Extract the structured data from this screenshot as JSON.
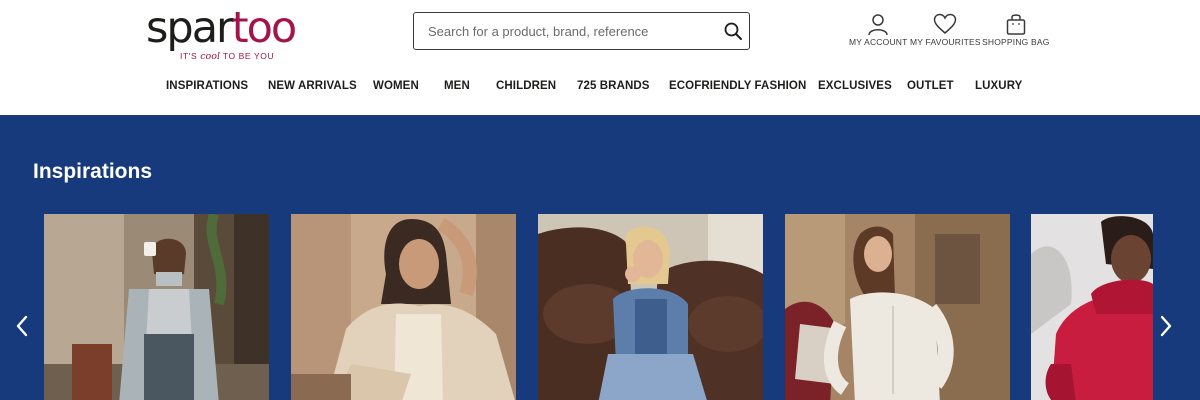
{
  "brand": {
    "name_part1": "spar",
    "name_part2": "too",
    "tagline_before": "IT'S ",
    "tagline_emph": "cool",
    "tagline_after": " TO BE YOU",
    "color_dark": "#1d1d1b",
    "color_accent": "#a3154a"
  },
  "search": {
    "placeholder": "Search for a product, brand, reference",
    "value": "",
    "icon": "search-icon"
  },
  "top_actions": [
    {
      "label": "MY ACCOUNT",
      "icon": "user-icon"
    },
    {
      "label": "MY FAVOURITES",
      "icon": "heart-icon"
    },
    {
      "label": "SHOPPING BAG",
      "icon": "shopping-bag-icon"
    }
  ],
  "nav": [
    {
      "label": "INSPIRATIONS"
    },
    {
      "label": "NEW ARRIVALS"
    },
    {
      "label": "WOMEN"
    },
    {
      "label": "MEN"
    },
    {
      "label": "CHILDREN"
    },
    {
      "label": "725 BRANDS"
    },
    {
      "label": "ECOFRIENDLY FASHION"
    },
    {
      "label": "EXCLUSIVES"
    },
    {
      "label": "OUTLET"
    },
    {
      "label": "LUXURY"
    }
  ],
  "inspirations": {
    "title": "Inspirations",
    "background": "#173a7c",
    "prev_icon": "chevron-left-icon",
    "next_icon": "chevron-right-icon"
  }
}
